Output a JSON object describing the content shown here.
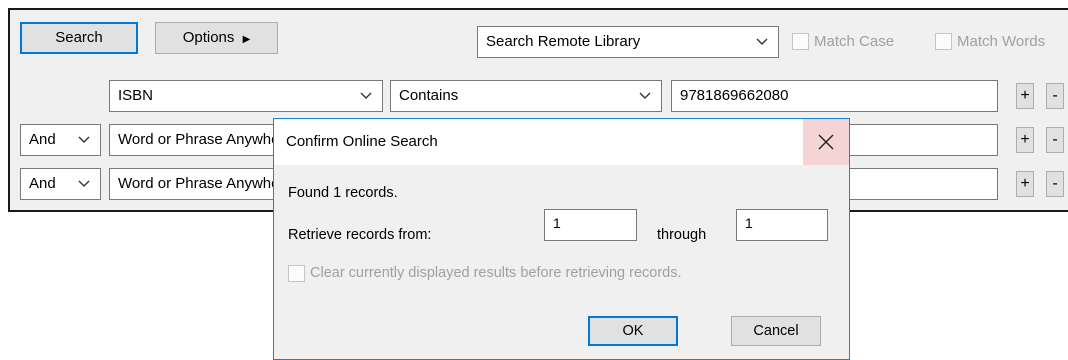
{
  "toolbar": {
    "search_label": "Search",
    "options_label": "Options",
    "source_selected": "Search Remote Library",
    "match_case_label": "Match Case",
    "match_words_label": "Match Words"
  },
  "rows": [
    {
      "connector": "",
      "field": "ISBN",
      "operator": "Contains",
      "value": "9781869662080"
    },
    {
      "connector": "And",
      "field": "Word or Phrase Anywhere",
      "operator": "",
      "value": ""
    },
    {
      "connector": "And",
      "field": "Word or Phrase Anywhere",
      "operator": "",
      "value": ""
    }
  ],
  "row_buttons": {
    "plus": "+",
    "minus": "-"
  },
  "dialog": {
    "title": "Confirm Online Search",
    "found_text": "Found 1 records.",
    "retrieve_label": "Retrieve records from:",
    "from_value": "1",
    "through_label": "through",
    "to_value": "1",
    "clear_label": "Clear currently displayed results before retrieving records.",
    "ok_label": "OK",
    "cancel_label": "Cancel"
  }
}
